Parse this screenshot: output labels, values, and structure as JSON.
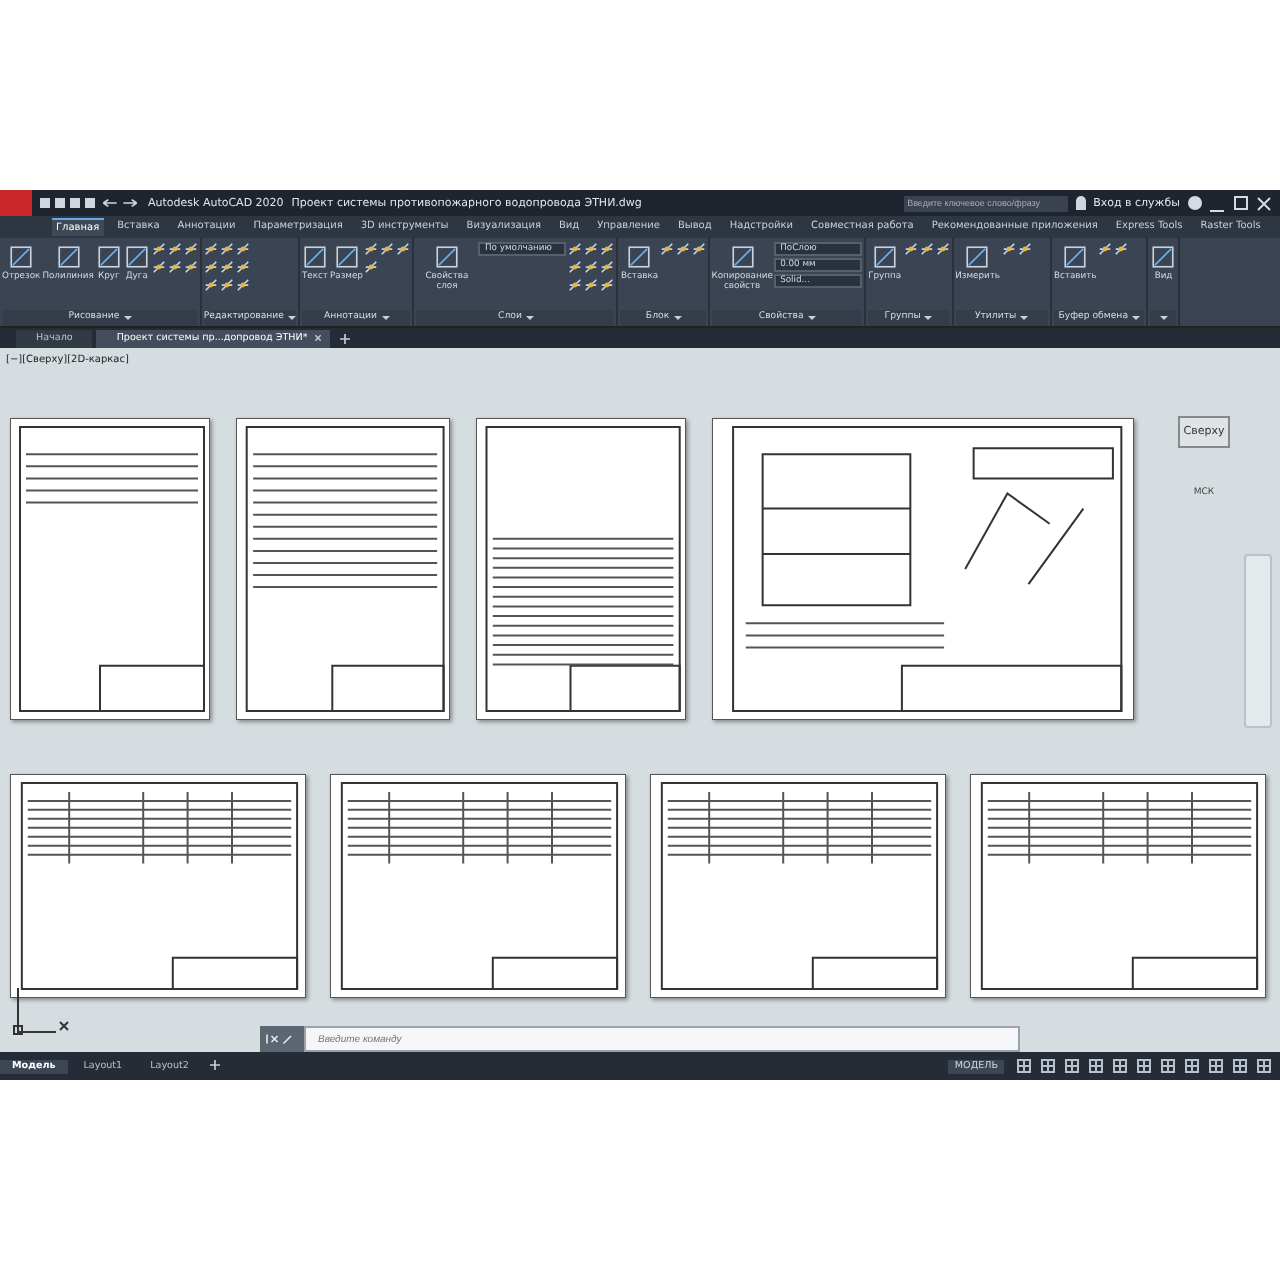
{
  "title_bar": {
    "app": "Autodesk AutoCAD 2020",
    "file": "Проект системы противопожарного водопровода ЭТНИ.dwg",
    "search": {
      "placeholder": "Введите ключевое слово/фразу"
    },
    "sign_in": "Вход в службы"
  },
  "ribbon_tabs": [
    {
      "label": "Главная",
      "selected": true
    },
    {
      "label": "Вставка",
      "selected": false
    },
    {
      "label": "Аннотации",
      "selected": false
    },
    {
      "label": "Параметризация",
      "selected": false
    },
    {
      "label": "3D инструменты",
      "selected": false
    },
    {
      "label": "Визуализация",
      "selected": false
    },
    {
      "label": "Вид",
      "selected": false
    },
    {
      "label": "Управление",
      "selected": false
    },
    {
      "label": "Вывод",
      "selected": false
    },
    {
      "label": "Надстройки",
      "selected": false
    },
    {
      "label": "Совместная работа",
      "selected": false
    },
    {
      "label": "Рекомендованные приложения",
      "selected": false
    },
    {
      "label": "Express Tools",
      "selected": false
    },
    {
      "label": "Raster Tools",
      "selected": false
    }
  ],
  "ribbon_panels": [
    {
      "title": "Рисование",
      "tools": [
        "Отрезок",
        "Полилиния",
        "Круг",
        "Дуга"
      ]
    },
    {
      "title": "Редактирование"
    },
    {
      "title": "Аннотации",
      "tools": [
        "Текст",
        "Размер"
      ]
    },
    {
      "title": "Слои",
      "tools": [
        "Свойства слоя"
      ],
      "layer": "По умолчанию"
    },
    {
      "title": "Блок",
      "tools": [
        "Вставка"
      ]
    },
    {
      "title": "Свойства",
      "tools": [
        "Копирование свойств"
      ],
      "fields": [
        "ПоСлою",
        "0.00 мм",
        "Solid..."
      ]
    },
    {
      "title": "Группы",
      "tools": [
        "Группа"
      ]
    },
    {
      "title": "Утилиты",
      "tools": [
        "Измерить"
      ]
    },
    {
      "title": "Буфер обмена",
      "tools": [
        "Вставить"
      ]
    },
    {
      "tools": [
        "Вид"
      ]
    }
  ],
  "doc_tabs": [
    {
      "label": "Начало",
      "selected": false,
      "closable": false
    },
    {
      "label": "Проект системы пр...допровод ЭТНИ*",
      "selected": true,
      "closable": true
    }
  ],
  "viewport_label": "[−][Сверху][2D-каркас]",
  "sheets": [
    {
      "kind": "portrait"
    },
    {
      "kind": "list"
    },
    {
      "kind": "text"
    },
    {
      "kind": "plan"
    },
    {
      "kind": "table"
    },
    {
      "kind": "table"
    },
    {
      "kind": "table"
    },
    {
      "kind": "table"
    }
  ],
  "viewcube": {
    "face": "Сверху",
    "ucs": "МСК"
  },
  "command_line": {
    "placeholder": "Введите команду"
  },
  "layout_tabs": [
    {
      "label": "Модель",
      "selected": true
    },
    {
      "label": "Layout1",
      "selected": false
    },
    {
      "label": "Layout2",
      "selected": false
    }
  ],
  "status_bar": {
    "mode": "МОДЕЛЬ"
  }
}
